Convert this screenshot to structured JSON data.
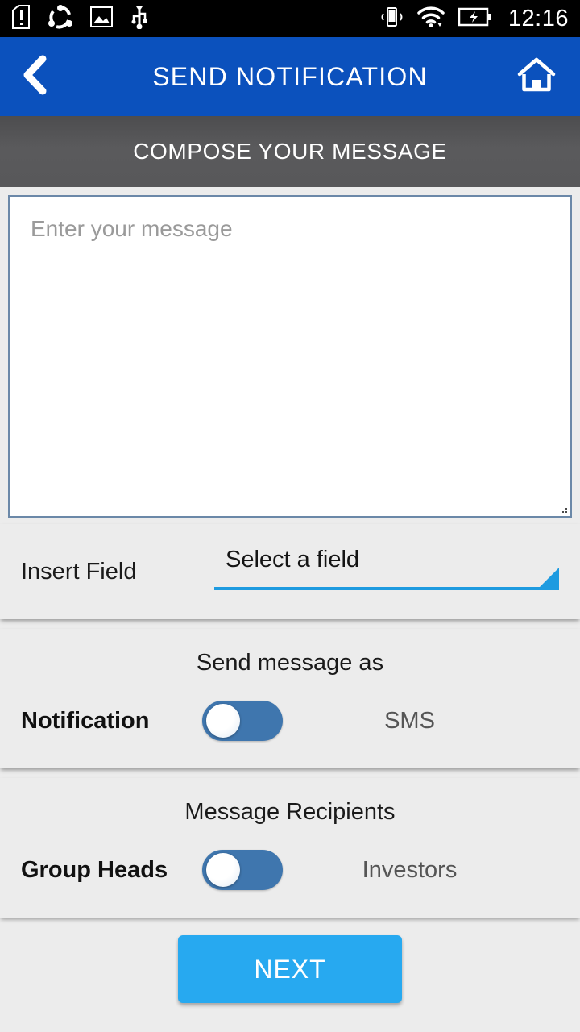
{
  "statusbar": {
    "time": "12:16",
    "left_icons": [
      {
        "name": "sim-card-alert-icon"
      },
      {
        "name": "sync-share-icon"
      },
      {
        "name": "image-icon"
      },
      {
        "name": "usb-icon"
      }
    ],
    "right_icons": [
      {
        "name": "vibrate-icon"
      },
      {
        "name": "wifi-icon"
      },
      {
        "name": "battery-charging-icon"
      }
    ]
  },
  "appbar": {
    "title": "SEND NOTIFICATION",
    "back_icon": "back-chevron-icon",
    "home_icon": "home-icon",
    "background": "#0b51bd"
  },
  "subheader": {
    "title": "COMPOSE YOUR MESSAGE",
    "background": "#58585a"
  },
  "message": {
    "placeholder": "Enter your message",
    "value": "",
    "border_color": "#6b88a8"
  },
  "insert_field": {
    "label": "Insert Field",
    "selected": "Select a field",
    "options": [
      "Select a field"
    ],
    "accent": "#1e9be0"
  },
  "send_as": {
    "heading": "Send message as",
    "left_option": "Notification",
    "right_option": "SMS",
    "selected": "Notification",
    "switch_color": "#3f76ae"
  },
  "recipients": {
    "heading": "Message Recipients",
    "left_option": "Group Heads",
    "right_option": "Investors",
    "selected": "Group Heads",
    "switch_color": "#3f76ae"
  },
  "footer": {
    "next_label": "NEXT",
    "next_color": "#27a9f0"
  }
}
